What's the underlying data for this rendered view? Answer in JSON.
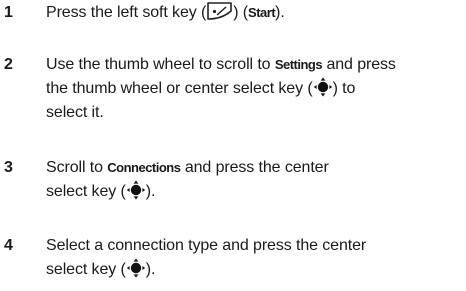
{
  "steps": [
    {
      "number": "1",
      "parts": {
        "a": "Press the left soft key (",
        "b": ") (",
        "key": "Start",
        "c": ")."
      },
      "icon": "soft-key-icon"
    },
    {
      "number": "2",
      "parts": {
        "a": "Use the thumb wheel to scroll to ",
        "key": "Settings",
        "b": " and press",
        "c": "the thumb wheel or center select key (",
        "d": ") to",
        "e": "select it."
      },
      "icon": "navigation-key-icon"
    },
    {
      "number": "3",
      "parts": {
        "a": "Scroll to ",
        "key": "Connections",
        "b": " and press the center",
        "c": "select key (",
        "d": ")."
      },
      "icon": "navigation-key-icon"
    },
    {
      "number": "4",
      "parts": {
        "a": "Select a connection type and press the center",
        "c": "select key (",
        "d": ")."
      },
      "icon": "navigation-key-icon"
    }
  ]
}
